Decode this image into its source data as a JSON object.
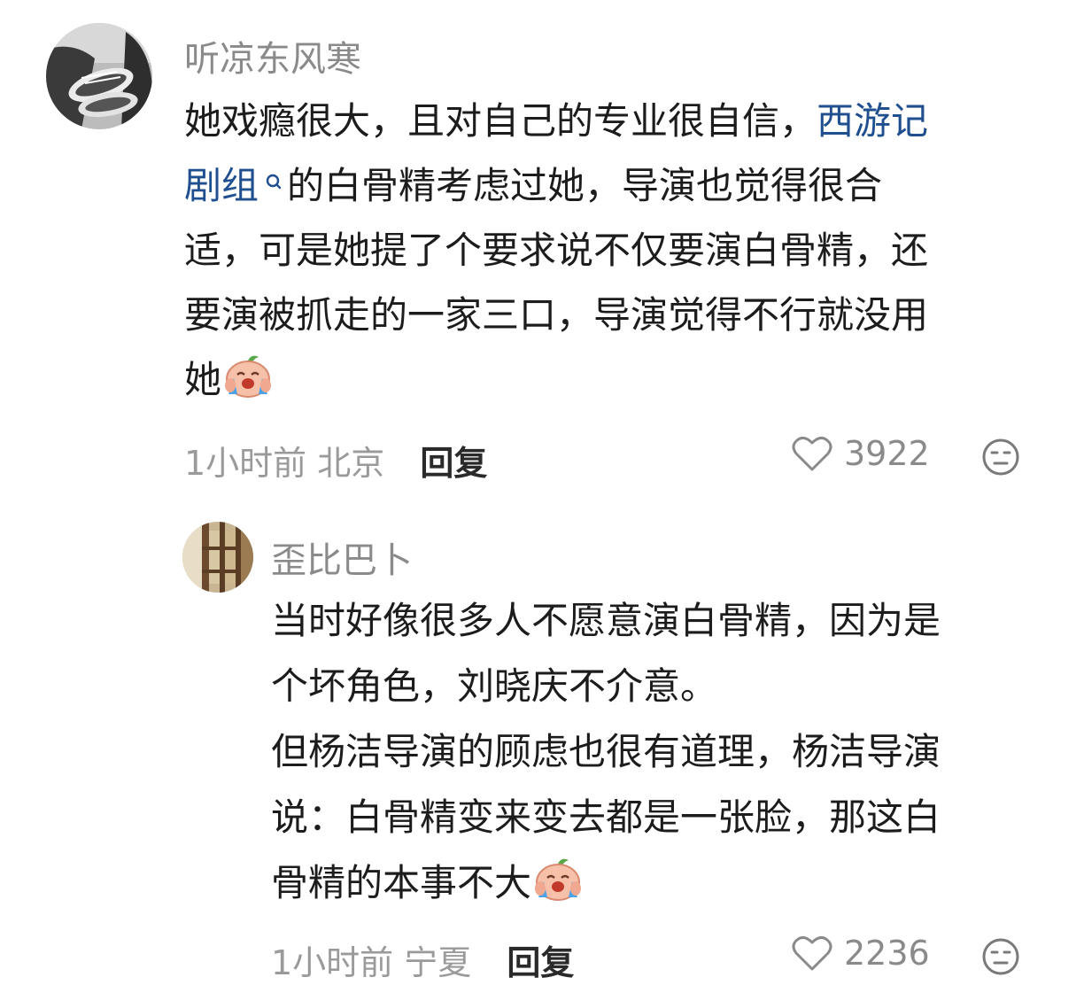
{
  "comments": [
    {
      "username": "听凉东风寒",
      "avatar_icon": "sneakers-photo-avatar",
      "lines": [
        {
          "pre": "她戏瘾很大，且对自己的专业很自信，",
          "link": "西游记"
        },
        {
          "link": "剧组",
          "post": "的白骨精考虑过她，导演也觉得很合"
        },
        {
          "text": "适，可是她提了个要求说不仅要演白骨精，还"
        },
        {
          "text": "要演被抓走的一家三口，导演觉得不行就没用"
        },
        {
          "text": "她"
        }
      ],
      "time": "1小时前",
      "location": "北京",
      "reply_label": "回复",
      "likes": "3922"
    },
    {
      "username": "歪比巴卜",
      "avatar_icon": "window-lattice-photo-avatar",
      "lines": [
        {
          "text": "当时好像很多人不愿意演白骨精，因为是"
        },
        {
          "text": "个坏角色，刘晓庆不介意。"
        },
        {
          "text": "但杨洁导演的顾虑也很有道理，杨洁导演"
        },
        {
          "text": "说：白骨精变来变去都是一张脸，那这白"
        },
        {
          "text": "骨精的本事不大"
        }
      ],
      "time": "1小时前",
      "location": "宁夏",
      "reply_label": "回复",
      "likes": "2236"
    }
  ],
  "colors": {
    "username": "#8a8a8a",
    "link": "#1f4f8f",
    "meta": "#9a9a9a",
    "text": "#1c1c1c"
  },
  "icons": {
    "link_search": "search-icon",
    "emoji": "crying-peach-emoji",
    "like": "heart-outline-icon",
    "emoji_react": "neutral-face-icon"
  }
}
